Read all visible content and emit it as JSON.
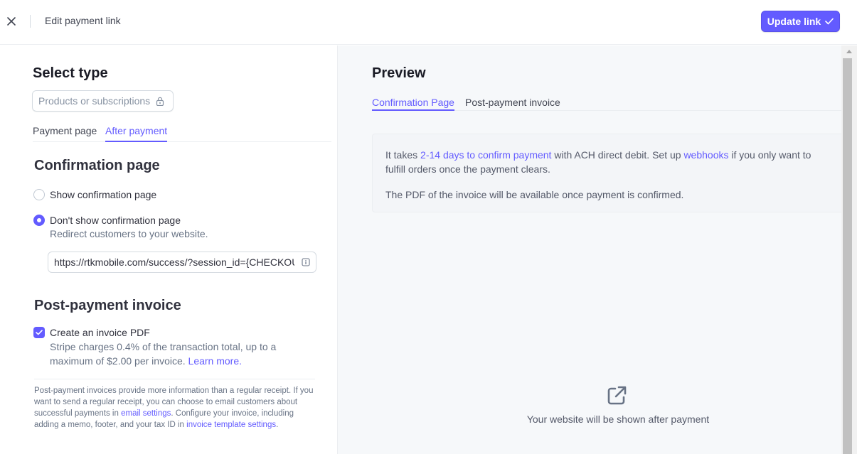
{
  "header": {
    "title": "Edit payment link",
    "update_label": "Update link"
  },
  "left": {
    "title": "Select type",
    "type_select": "Products or subscriptions",
    "tabs": [
      {
        "label": "Payment page",
        "active": false
      },
      {
        "label": "After payment",
        "active": true
      }
    ],
    "confirmation": {
      "heading": "Confirmation page",
      "show_label": "Show confirmation page",
      "dont_show_label": "Don't show confirmation page",
      "dont_show_sub": "Redirect customers to your website.",
      "selected": "dont_show",
      "url_value": "https://rtkmobile.com/success/?session_id={CHECKOUT_SESSION_ID}"
    },
    "invoice": {
      "heading": "Post-payment invoice",
      "checkbox_label": "Create an invoice PDF",
      "checked": true,
      "desc": "Stripe charges 0.4% of the transaction total, up to a maximum of $2.00 per invoice.",
      "learn_more": "Learn more.",
      "footer_part1": "Post-payment invoices provide more information than a regular receipt. If you want to send a regular receipt, you can choose to email customers about successful payments in",
      "footer_link1": "email settings",
      "footer_part2": ". Configure your invoice, including adding a memo, footer, and your tax ID in",
      "footer_link2": "invoice template settings",
      "footer_part3": "."
    }
  },
  "right": {
    "title": "Preview",
    "tabs": [
      {
        "label": "Confirmation Page",
        "active": true
      },
      {
        "label": "Post-payment invoice",
        "active": false
      }
    ],
    "notice": {
      "p1_part1": "It takes",
      "p1_link1": "2-14 days to confirm payment",
      "p1_part2": "with ACH direct debit. Set up",
      "p1_link2": "webhooks",
      "p1_part3": "if you only want to fulfill orders once the payment clears.",
      "p2": "The PDF of the invoice will be available once payment is confirmed."
    },
    "after_payment_text": "Your website will be shown after payment"
  },
  "colors": {
    "accent": "#635bff",
    "text": "#30313d",
    "muted": "#687385",
    "panel_bg": "#f6f8fa"
  },
  "icons": {
    "close": "close-icon",
    "check": "checkmark-icon",
    "lock": "lock-icon",
    "info": "info-icon",
    "external": "external-link-icon"
  }
}
